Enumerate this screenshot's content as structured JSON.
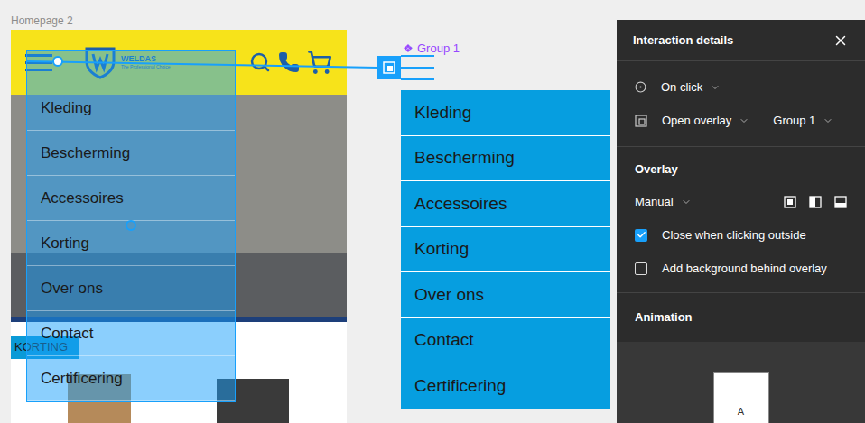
{
  "canvas": {
    "frame_label": "Homepage 2",
    "component_marker": "❖",
    "component_label": "Group 1"
  },
  "header": {
    "brand": "WELDAS",
    "tagline": "The Professional Choice"
  },
  "badge": "KORTING",
  "menu_items": [
    "Kleding",
    "Bescherming",
    "Accessoires",
    "Korting",
    "Over ons",
    "Contact",
    "Certificering"
  ],
  "panel": {
    "title": "Interaction details",
    "trigger": "On click",
    "action": "Open overlay",
    "destination": "Group 1",
    "overlay_heading": "Overlay",
    "position": "Manual",
    "options": [
      {
        "label": "Close when clicking outside",
        "checked": true
      },
      {
        "label": "Add background behind overlay",
        "checked": false
      }
    ],
    "animation_heading": "Animation",
    "preview_label": "A"
  }
}
